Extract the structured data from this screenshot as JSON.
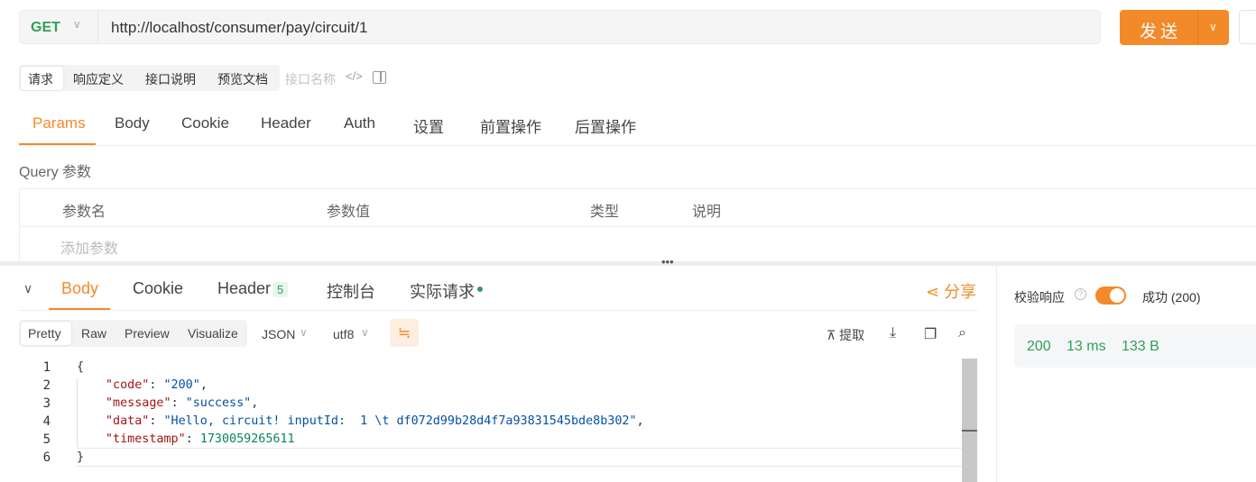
{
  "request": {
    "method": "GET",
    "url": "http://localhost/consumer/pay/circuit/1",
    "send_label": "发送"
  },
  "doc_tabs": [
    {
      "label": "请求"
    },
    {
      "label": "响应定义"
    },
    {
      "label": "接口说明"
    },
    {
      "label": "预览文档"
    }
  ],
  "interface_name_placeholder": "接口名称",
  "request_tabs": [
    {
      "label": "Params"
    },
    {
      "label": "Body"
    },
    {
      "label": "Cookie"
    },
    {
      "label": "Header"
    },
    {
      "label": "Auth"
    },
    {
      "label": "设置"
    },
    {
      "label": "前置操作"
    },
    {
      "label": "后置操作"
    }
  ],
  "query": {
    "title": "Query 参数",
    "columns": [
      "参数名",
      "参数值",
      "类型",
      "说明"
    ],
    "add_placeholder": "添加参数"
  },
  "response_tabs": [
    {
      "label": "Body"
    },
    {
      "label": "Cookie"
    },
    {
      "label": "Header"
    },
    {
      "label": "控制台"
    },
    {
      "label": "实际请求"
    }
  ],
  "header_count": "5",
  "share_label": "分享",
  "view_tabs": [
    {
      "label": "Pretty"
    },
    {
      "label": "Raw"
    },
    {
      "label": "Preview"
    },
    {
      "label": "Visualize"
    }
  ],
  "format_select": "JSON",
  "encoding_select": "utf8",
  "extract_label": "提取",
  "code": {
    "line_numbers": [
      "1",
      "2",
      "3",
      "4",
      "5",
      "6"
    ],
    "open_brace": "{",
    "close_brace": "}",
    "fields": [
      {
        "key": "\"code\"",
        "value": "\"200\"",
        "trail": ","
      },
      {
        "key": "\"message\"",
        "value": "\"success\"",
        "trail": ","
      },
      {
        "key": "\"data\"",
        "value": "\"Hello, circuit! inputId:  1 \\t df072d99b28d4f7a93831545bde8b302\"",
        "trail": ","
      },
      {
        "key": "\"timestamp\"",
        "value": "1730059265611",
        "trail": ""
      }
    ]
  },
  "validation": {
    "label": "校验响应",
    "enabled": true,
    "result": "成功 (200)"
  },
  "stats": {
    "status": "200",
    "time": "13 ms",
    "size": "133 B"
  },
  "colors": {
    "accent": "#f38a29",
    "success": "#2fa05a"
  }
}
